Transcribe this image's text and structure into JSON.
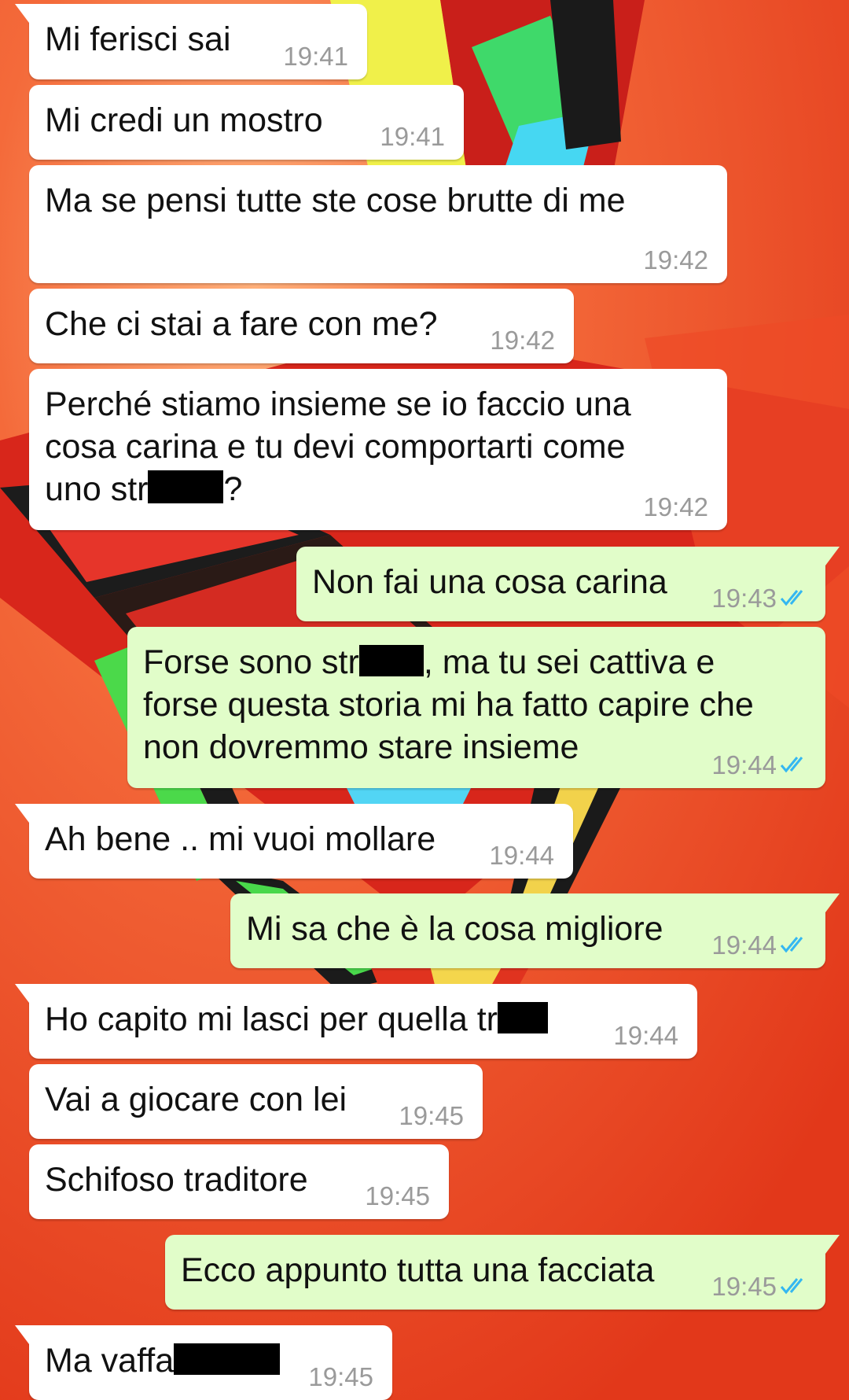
{
  "chat": {
    "messages": [
      {
        "direction": "in",
        "text": "Mi ferisci sai",
        "time": "19:41"
      },
      {
        "direction": "in",
        "text": "Mi credi un mostro",
        "time": "19:41"
      },
      {
        "direction": "in",
        "text": "Ma se pensi tutte ste cose brutte di me",
        "time": "19:42"
      },
      {
        "direction": "in",
        "text": "Che ci stai a fare con me?",
        "time": "19:42"
      },
      {
        "direction": "in",
        "line1": "Perché stiamo insieme se io faccio una",
        "line2": "cosa carina e tu devi comportarti come",
        "line3_before": "uno str",
        "line3_after": "?",
        "time": "19:42"
      },
      {
        "direction": "out",
        "text": "Non fai una cosa carina",
        "time": "19:43",
        "status": "read"
      },
      {
        "direction": "out",
        "line1_before": "Forse sono str",
        "line1_after": ", ma tu sei cattiva e",
        "line2": "forse questa storia mi ha fatto capire che",
        "line3": "non dovremmo stare insieme",
        "time": "19:44",
        "status": "read"
      },
      {
        "direction": "in",
        "text": "Ah bene .. mi vuoi mollare",
        "time": "19:44"
      },
      {
        "direction": "out",
        "text": "Mi sa che è la cosa migliore",
        "time": "19:44",
        "status": "read"
      },
      {
        "direction": "in",
        "text_before": "Ho capito mi lasci per quella tr",
        "time": "19:44"
      },
      {
        "direction": "in",
        "text": "Vai a giocare con lei",
        "time": "19:45"
      },
      {
        "direction": "in",
        "text": "Schifoso traditore",
        "time": "19:45"
      },
      {
        "direction": "out",
        "text": "Ecco appunto tutta una facciata",
        "time": "19:45",
        "status": "read"
      },
      {
        "direction": "in",
        "text_before": "Ma vaffa",
        "time": "19:45"
      }
    ]
  },
  "colors": {
    "incoming_bubble": "#ffffff",
    "outgoing_bubble": "#e1fdc9",
    "timestamp": "#9a9a9a",
    "read_ticks": "#34b7f1",
    "redaction": "#000000"
  },
  "icons": {
    "read_status": "double-check-icon"
  }
}
